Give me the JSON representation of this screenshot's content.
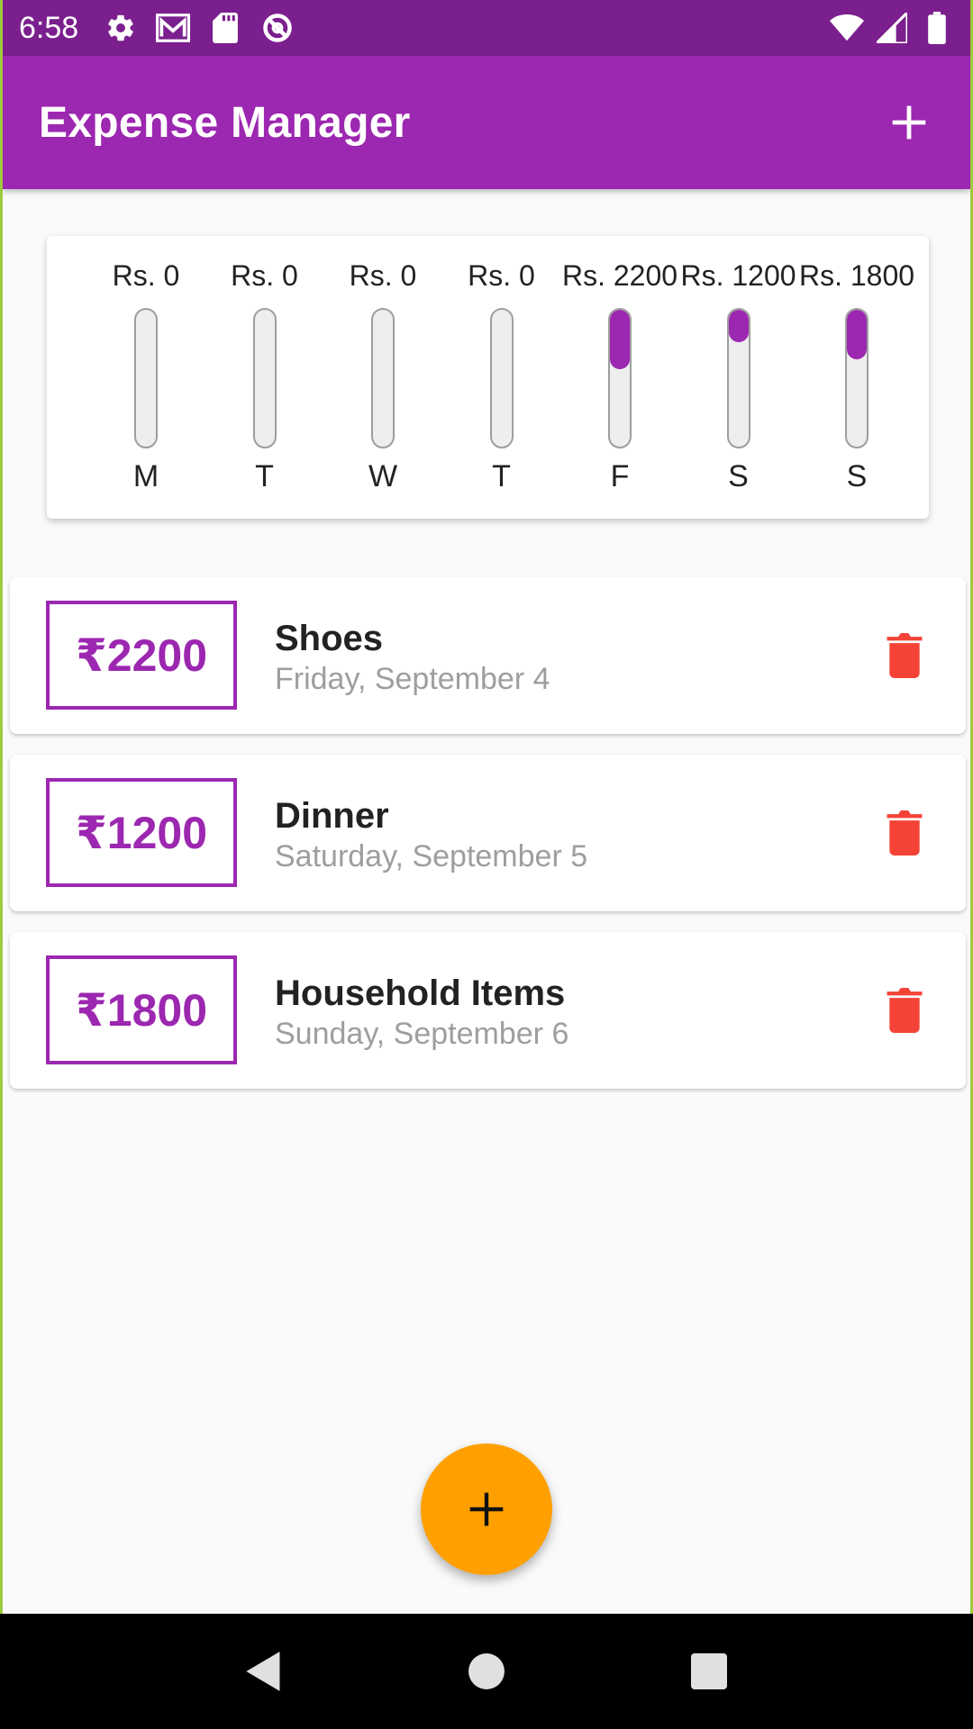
{
  "status_bar": {
    "time": "6:58",
    "left_icons": [
      "settings-icon",
      "gmail-icon",
      "sd-card-icon",
      "data-saver-icon"
    ],
    "right_icons": [
      "wifi-icon",
      "signal-icon",
      "battery-icon"
    ]
  },
  "app_bar": {
    "title": "Expense Manager",
    "add_icon": "plus-icon"
  },
  "chart": {
    "accent_color": "#9c27b0",
    "days": [
      {
        "label": "M",
        "amount_label": "Rs. 0",
        "fraction": 0.0
      },
      {
        "label": "T",
        "amount_label": "Rs. 0",
        "fraction": 0.0
      },
      {
        "label": "W",
        "amount_label": "Rs. 0",
        "fraction": 0.0
      },
      {
        "label": "T",
        "amount_label": "Rs. 0",
        "fraction": 0.0
      },
      {
        "label": "F",
        "amount_label": "Rs. 2200",
        "fraction": 0.42
      },
      {
        "label": "S",
        "amount_label": "Rs. 1200",
        "fraction": 0.23
      },
      {
        "label": "S",
        "amount_label": "Rs. 1800",
        "fraction": 0.35
      }
    ]
  },
  "expenses": [
    {
      "amount": "₹2200",
      "title": "Shoes",
      "date": "Friday, September 4"
    },
    {
      "amount": "₹1200",
      "title": "Dinner",
      "date": "Saturday, September 5"
    },
    {
      "amount": "₹1800",
      "title": "Household Items",
      "date": "Sunday, September 6"
    }
  ],
  "colors": {
    "primary": "#9c27b0",
    "status_bar": "#7b1f8e",
    "fab": "#ffa000",
    "delete": "#f44336"
  },
  "fab": {
    "icon": "plus-icon"
  },
  "nav_bar": {
    "icons": [
      "back-icon",
      "home-icon",
      "recents-icon"
    ]
  }
}
